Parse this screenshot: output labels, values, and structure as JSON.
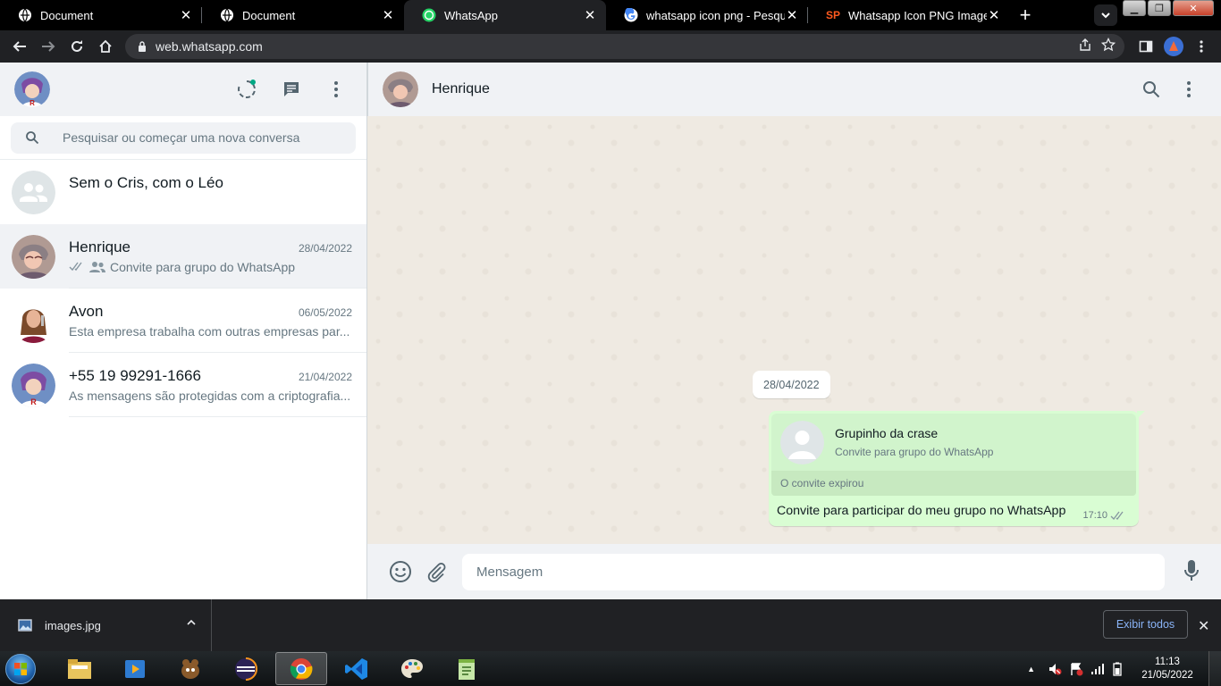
{
  "browser": {
    "tabs": [
      {
        "title": "Document",
        "icon": "globe-icon",
        "active": false
      },
      {
        "title": "Document",
        "icon": "globe-icon",
        "active": false
      },
      {
        "title": "WhatsApp",
        "icon": "whatsapp-icon",
        "active": true
      },
      {
        "title": "whatsapp icon png - Pesquisa",
        "icon": "google-icon",
        "active": false
      },
      {
        "title": "Whatsapp Icon PNG Images | ",
        "icon": "sp-icon",
        "active": false
      }
    ],
    "sp_label": "SP",
    "url": "web.whatsapp.com"
  },
  "sidebar": {
    "search_placeholder": "Pesquisar ou começar uma nova conversa",
    "chats": [
      {
        "name": "Sem o Cris, com o Léo",
        "date": "",
        "preview": ""
      },
      {
        "name": "Henrique",
        "date": "28/04/2022",
        "preview": "Convite para grupo do WhatsApp"
      },
      {
        "name": "Avon",
        "date": "06/05/2022",
        "preview": "Esta empresa trabalha com outras empresas par..."
      },
      {
        "name": "+55 19 99291-1666",
        "date": "21/04/2022",
        "preview": "As mensagens são protegidas com a criptografia..."
      }
    ]
  },
  "chat": {
    "contact_name": "Henrique",
    "date_chip": "28/04/2022",
    "invite": {
      "group_name": "Grupinho da crase",
      "subtitle": "Convite para grupo do WhatsApp",
      "expired": "O convite expirou"
    },
    "message_text": "Convite para participar do meu grupo no WhatsApp",
    "message_time": "17:10",
    "input_placeholder": "Mensagem"
  },
  "downloads": {
    "file_name": "images.jpg",
    "show_all": "Exibir todos"
  },
  "taskbar": {
    "time": "11:13",
    "date": "21/05/2022"
  },
  "colors": {
    "accent": "#00a884",
    "outgoing_bubble": "#d9fdd3",
    "chat_background": "#efeae2"
  }
}
